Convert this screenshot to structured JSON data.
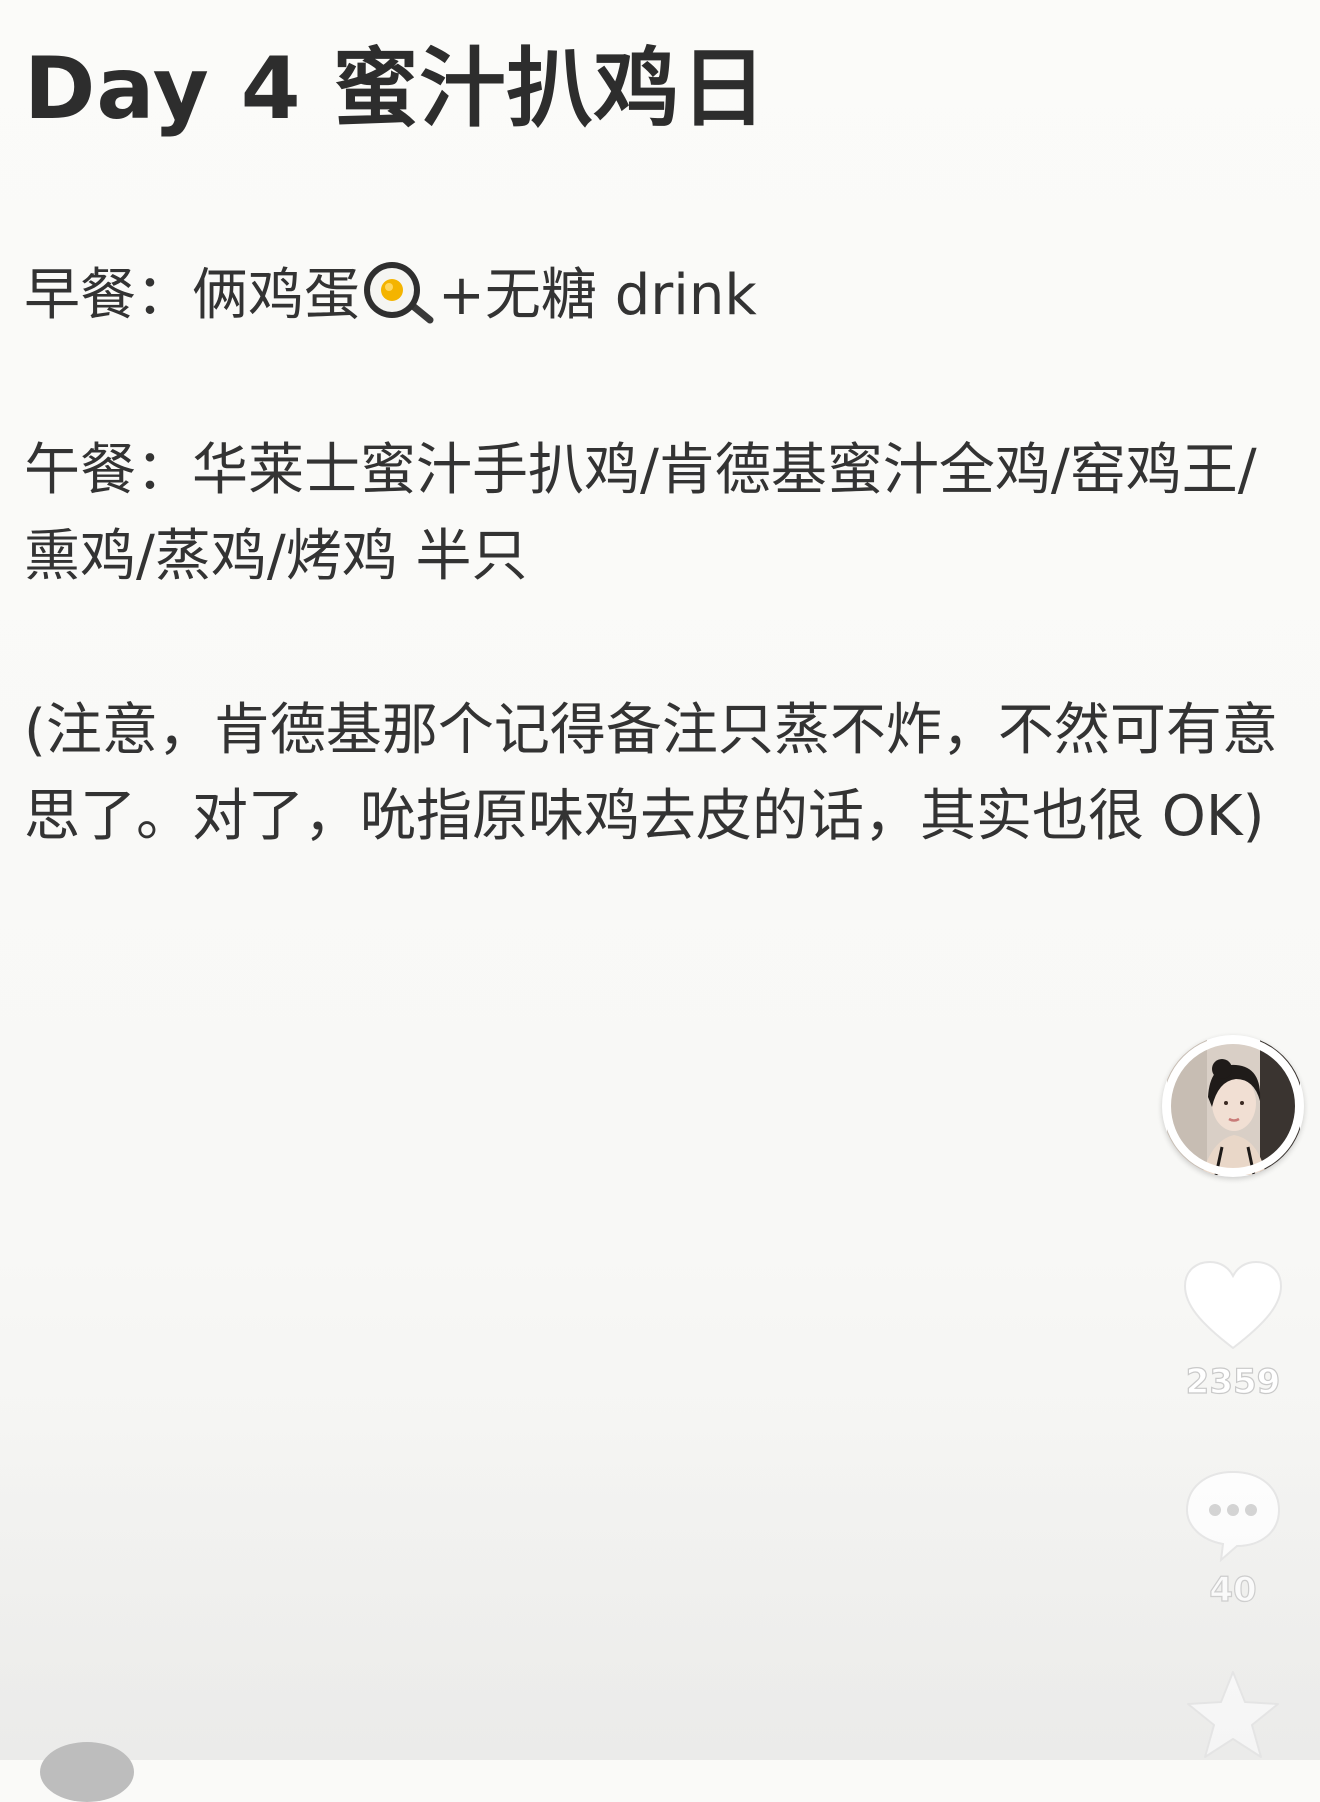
{
  "post": {
    "title": "Day 4 蜜汁扒鸡日",
    "breakfast": {
      "before_icon": "早餐：俩鸡蛋",
      "icon": "fried-egg-icon",
      "after_icon": "+无糖 drink"
    },
    "lunch_lines": [
      "午餐：华莱士蜜汁手扒鸡/肯德基蜜汁全鸡/窑鸡王/",
      "熏鸡/蒸鸡/烤鸡 半只"
    ],
    "note_lines": [
      "(注意，肯德基那个记得备注只蒸不炸，不然可有意",
      "思了。对了，吮指原味鸡去皮的话，其实也很 OK)"
    ]
  },
  "actions": {
    "like_count": "2359",
    "comment_count": "40"
  },
  "icons": {
    "like": "heart-icon",
    "comment": "chat-bubble-icon",
    "favorite": "star-icon",
    "avatar": "avatar"
  }
}
